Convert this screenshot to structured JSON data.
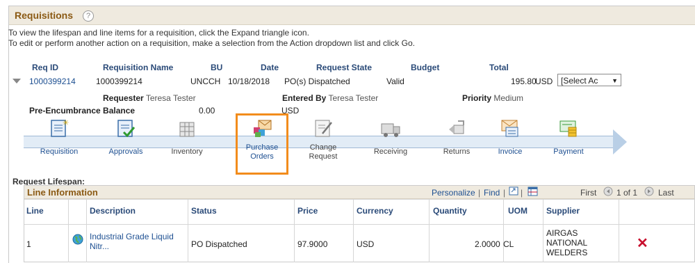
{
  "header": {
    "title": "Requisitions",
    "help": "?"
  },
  "instructions": [
    "To view the lifespan and line items for a requisition, click the Expand triangle icon.",
    "To edit or perform another action on a requisition, make a selection from the Action dropdown list and click Go."
  ],
  "columns": [
    "Req ID",
    "Requisition Name",
    "BU",
    "Date",
    "Request State",
    "Budget",
    "Total"
  ],
  "requisition": {
    "req_id": "1000399214",
    "name": "1000399214",
    "bu": "UNCCH",
    "date": "10/18/2018",
    "state": "PO(s) Dispatched",
    "budget": "Valid",
    "total": "195.80",
    "currency": "USD",
    "action": "[Select Ac"
  },
  "details": {
    "requester_label": "Requester",
    "requester": "Teresa Tester",
    "entered_by_label": "Entered By",
    "entered_by": "Teresa Tester",
    "priority_label": "Priority",
    "priority": "Medium",
    "pre_enc_label": "Pre-Encumbrance Balance",
    "pre_enc_value": "0.00",
    "pre_enc_currency": "USD"
  },
  "lifespan_stages": [
    {
      "line1": "Requisition",
      "line2": "",
      "icon": "requisition-icon"
    },
    {
      "line1": "Approvals",
      "line2": "",
      "icon": "approvals-icon"
    },
    {
      "line1": "Inventory",
      "line2": "",
      "icon": "inventory-icon"
    },
    {
      "line1": "Purchase",
      "line2": "Orders",
      "icon": "purchase-orders-icon"
    },
    {
      "line1": "Change",
      "line2": "Request",
      "icon": "change-request-icon"
    },
    {
      "line1": "Receiving",
      "line2": "",
      "icon": "receiving-icon"
    },
    {
      "line1": "Returns",
      "line2": "",
      "icon": "returns-icon"
    },
    {
      "line1": "Invoice",
      "line2": "",
      "icon": "invoice-icon"
    },
    {
      "line1": "Payment",
      "line2": "",
      "icon": "payment-icon"
    }
  ],
  "lifespan_label": "Request Lifespan:",
  "line_info": {
    "title": "Line Information",
    "personalize": "Personalize",
    "find": "Find",
    "first": "First",
    "pager": "1 of 1",
    "last": "Last",
    "headers": [
      "Line",
      "Description",
      "Status",
      "Price",
      "Currency",
      "Quantity",
      "UOM",
      "Supplier"
    ],
    "row": {
      "line": "1",
      "desc1": "Industrial Grade Liquid",
      "desc2": "Nitr...",
      "status": "PO Dispatched",
      "price": "97.9000",
      "currency": "USD",
      "quantity": "2.0000",
      "uom": "CL",
      "supplier1": "AIRGAS",
      "supplier2": "NATIONAL",
      "supplier3": "WELDERS"
    }
  }
}
